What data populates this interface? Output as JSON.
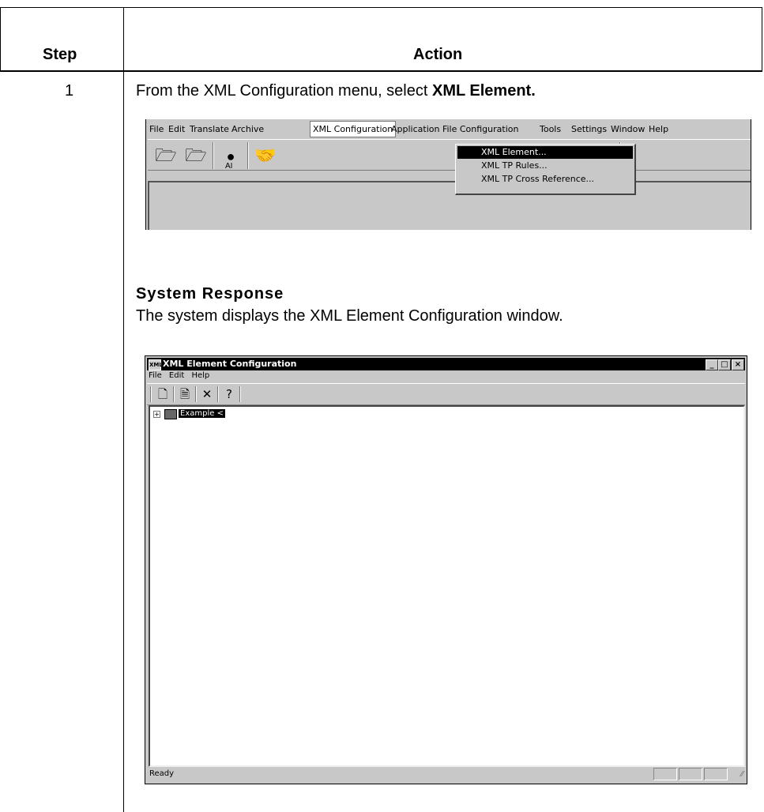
{
  "table": {
    "header_step": "Step",
    "header_action": "Action",
    "step_number": "1",
    "instruction_prefix": "From the XML Configuration menu, select ",
    "instruction_bold": "XML Element.",
    "system_response_title": "System Response",
    "system_response_text": "The system displays the XML Element Configuration window."
  },
  "screenshot1": {
    "menubar": [
      "File",
      "Edit",
      "Translate",
      "Archive",
      "XML Configuration",
      "Application File Configuration",
      "Tools",
      "Settings",
      "Window",
      "Help"
    ],
    "active_menu": "XML Configuration",
    "dropdown_items": [
      "XML Element...",
      "XML TP Rules...",
      "XML TP Cross Reference..."
    ],
    "selected_item": "XML Element...",
    "toolbar_icons": [
      "open-folder-icon",
      "open-folder-icon",
      "globe-ai-icon",
      "handshake-icon"
    ],
    "ai_label": "AI"
  },
  "screenshot2": {
    "window_title": "XML Element Configuration",
    "title_icon_text": "XML",
    "menu": [
      "File",
      "Edit",
      "Help"
    ],
    "toolbar_icons": [
      "new-document-icon",
      "document-icon",
      "delete-icon",
      "help-icon"
    ],
    "tree_node": "Example <",
    "status_text": "Ready",
    "window_buttons": [
      "minimize-icon",
      "maximize-icon",
      "close-icon"
    ]
  }
}
